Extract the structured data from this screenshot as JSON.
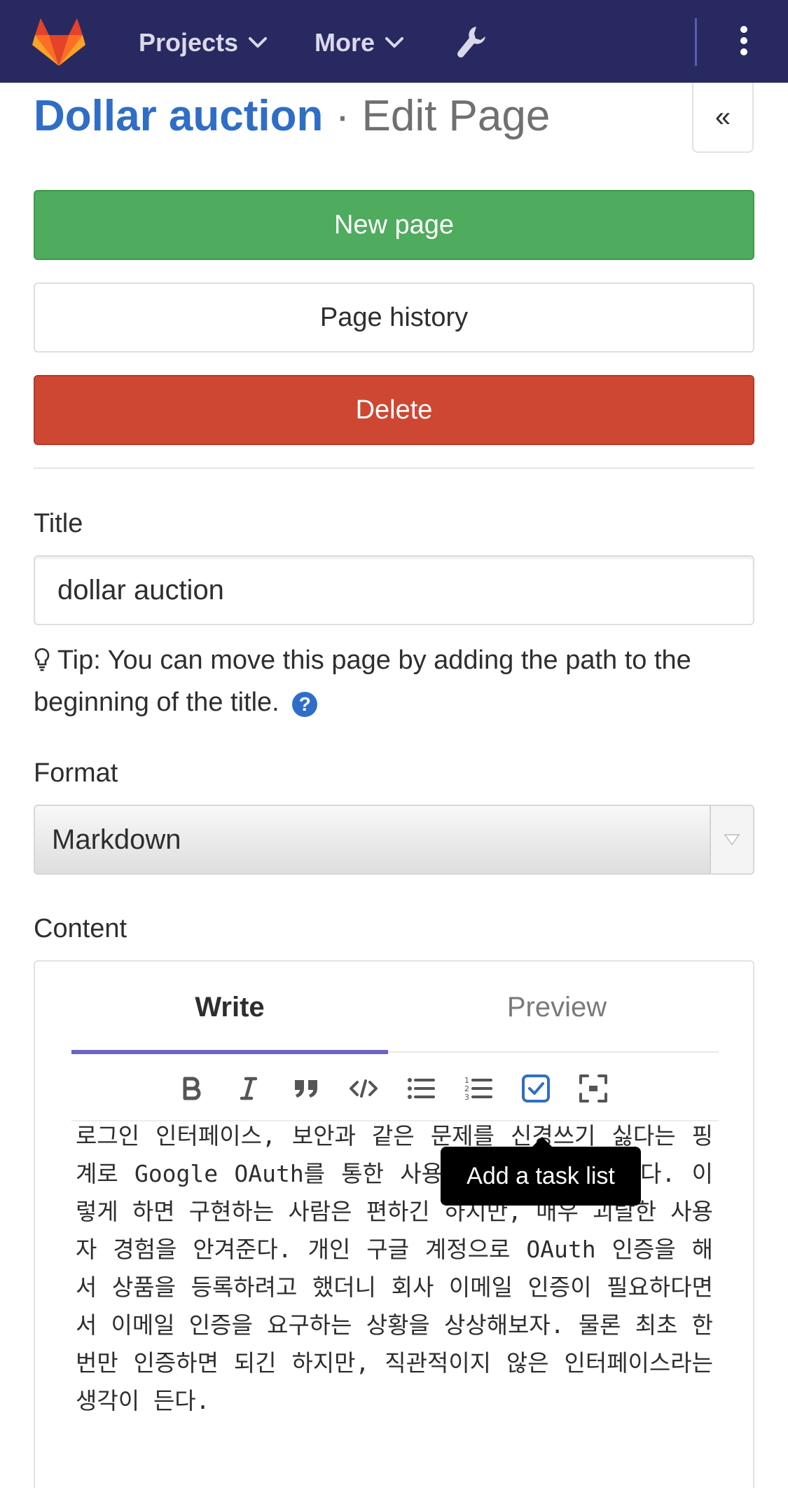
{
  "navbar": {
    "projects_label": "Projects",
    "more_label": "More",
    "icons": {
      "logo": "gitlab-tanuki-icon",
      "admin": "wrench-icon",
      "menu": "kebab-icon"
    },
    "colors": {
      "background": "#292961",
      "text": "#d9d9ea"
    }
  },
  "header": {
    "wiki_name": "Dollar auction",
    "separator": " · ",
    "page_action": "Edit Page",
    "collapse_label": "«"
  },
  "actions": {
    "new_page": "New page",
    "page_history": "Page history",
    "delete": "Delete",
    "colors": {
      "new_page": "#4fab5d",
      "delete": "#cd4733"
    }
  },
  "form": {
    "title_label": "Title",
    "title_value": "dollar auction",
    "tip_text": "Tip: You can move this page by adding the path to the beginning of the title.",
    "help_glyph": "?",
    "format_label": "Format",
    "format_value": "Markdown",
    "content_label": "Content"
  },
  "editor": {
    "tabs": {
      "write": "Write",
      "preview": "Preview"
    },
    "toolbar_icons": [
      "bold-icon",
      "italic-icon",
      "quote-icon",
      "code-icon",
      "bullet-list-icon",
      "numbered-list-icon",
      "task-list-icon",
      "fullscreen-icon"
    ],
    "content": "로그인 인터페이스, 보안과 같은 문제를 신경쓰기 싫다는 핑계로 Google OAuth를 통한 사용자 인증을 하고 있다. 이렇게 하면 구현하는 사람은 편하긴 하지만, 매우 괴랄한 사용자 경험을 안겨준다. 개인 구글 계정으로 OAuth 인증을 해서 상품을 등록하려고 했더니 회사 이메일 인증이 필요하다면서 이메일 인증을 요구하는 상황을 상상해보자. 물론 최초 한 번만 인증하면 되긴 하지만, 직관적이지 않은 인터페이스라는 생각이 든다.",
    "tooltip": "Add a task list",
    "colors": {
      "active_tab": "#6b63c7",
      "active_tool": "#2f6ec7"
    }
  }
}
